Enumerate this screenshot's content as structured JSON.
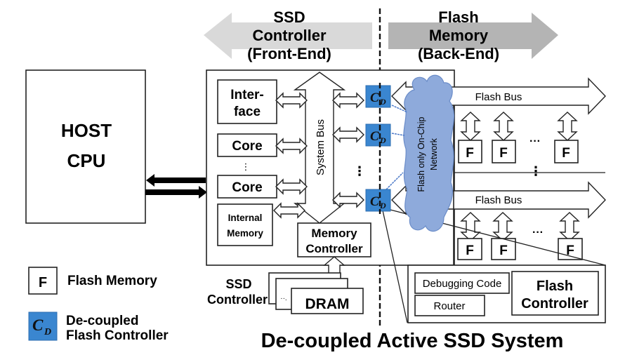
{
  "header": {
    "left_arrow": {
      "line1": "SSD",
      "line2": "Controller",
      "line3": "(Front-End)",
      "color": "#d9d9d9"
    },
    "right_arrow": {
      "line1": "Flash",
      "line2": "Memory",
      "line3": "(Back-End)",
      "color": "#b4b4b4"
    }
  },
  "host": {
    "line1": "HOST",
    "line2": "CPU"
  },
  "controller": {
    "interface": {
      "line1": "Inter-",
      "line2": "face"
    },
    "cores": [
      "Core",
      "Core"
    ],
    "core_ellipsis": "⋮",
    "internal_memory": {
      "line1": "Internal",
      "line2": "Memory"
    },
    "memory_controller": {
      "line1": "Memory",
      "line2": "Controller"
    },
    "system_bus": "System Bus",
    "cd_ellipsis": "⋮",
    "cd_label_main": "C",
    "cd_label_sub": "D",
    "cd_color": "#3a86d0"
  },
  "network": {
    "label_line1": "Flash only On-Chip",
    "label_line2": "Network",
    "color": "#8eaadb"
  },
  "flash": {
    "bus_labels": [
      "Flash Bus",
      "Flash Bus"
    ],
    "chip_label": "F",
    "h_ellipsis": "···",
    "v_ellipsis": "⋮"
  },
  "dram": {
    "label": "DRAM",
    "side_line1": "SSD",
    "side_line2": "Controller",
    "dots": "··."
  },
  "detail": {
    "debugging_code": "Debugging Code",
    "router": "Router",
    "flash_controller_line1": "Flash",
    "flash_controller_line2": "Controller"
  },
  "legend": {
    "flash_icon": "F",
    "flash_label": "Flash Memory",
    "cd_line1": "De-coupled",
    "cd_line2": "Flash Controller"
  },
  "title": "De-coupled Active SSD System"
}
